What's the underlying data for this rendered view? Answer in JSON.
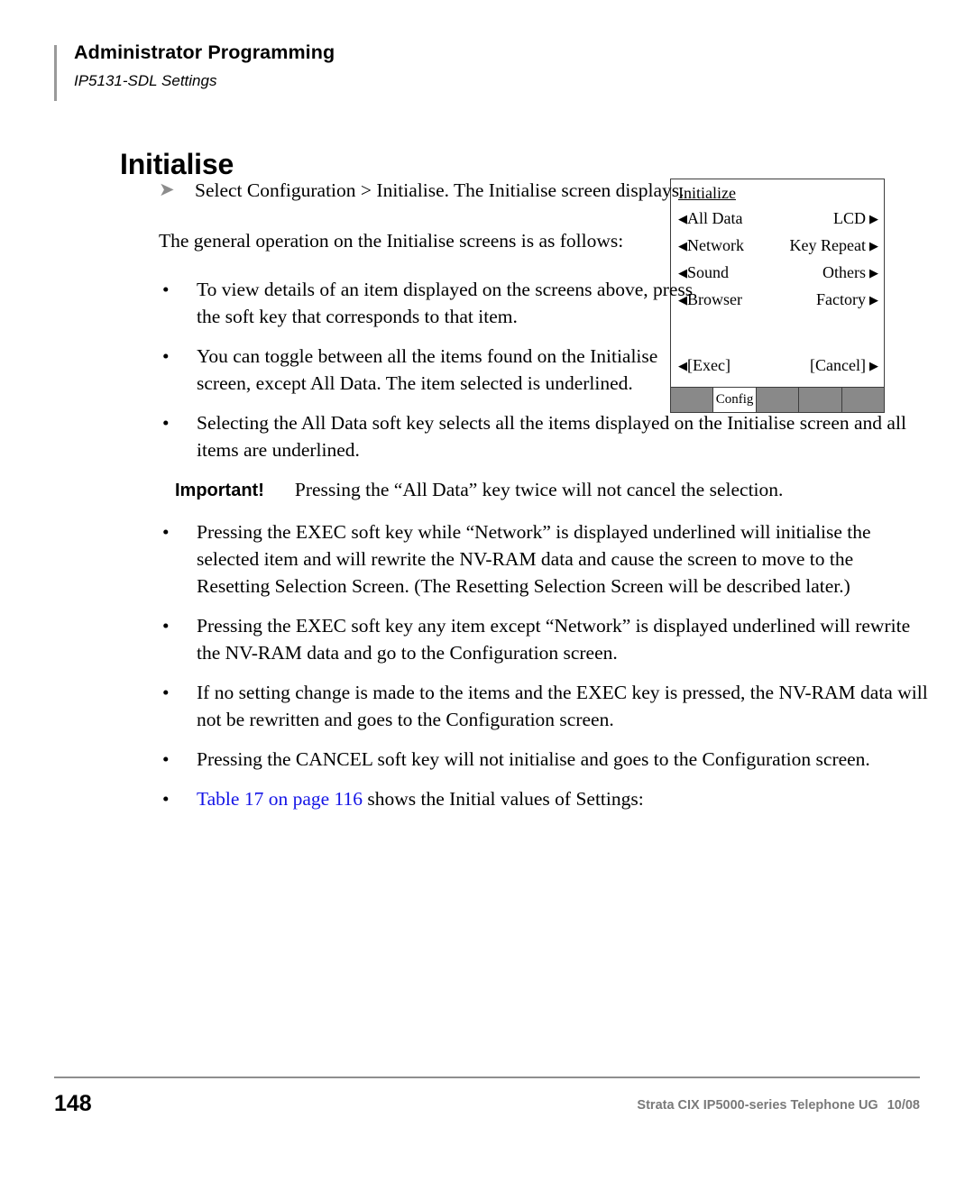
{
  "header": {
    "title": "Administrator Programming",
    "subtitle": "IP5131-SDL Settings"
  },
  "section": {
    "title": "Initialise"
  },
  "body": {
    "arrow_step": "Select Configuration > Initialise. The Initialise screen displays.",
    "intro": "The general operation on the Initialise screens is as follows:",
    "bullets": [
      "To view details of an item displayed on the screens above, press the soft key that corresponds to that item.",
      "You can toggle between all the items found on the Initialise screen, except All Data. The item selected is underlined.",
      "Selecting the All Data soft key selects all the items displayed on the Initialise screen and all items are underlined."
    ],
    "important": {
      "label": "Important!",
      "text": "Pressing the “All Data” key twice will not cancel the selection."
    },
    "bullets2": [
      "Pressing the EXEC soft key while “Network” is displayed underlined will initialise the selected item and will rewrite the NV-RAM data and cause the screen to move to the Resetting Selection Screen. (The Resetting Selection Screen will be described later.)",
      "Pressing the EXEC soft key any item except “Network” is displayed underlined will rewrite the NV-RAM data and go to the Configuration screen.",
      "If no setting change is made to the items and the EXEC key is pressed, the NV-RAM data will not be rewritten and goes to the Configuration screen.",
      "Pressing the CANCEL soft key will not initialise and goes to the Configuration screen."
    ],
    "table_ref": {
      "link": "Table 17 on page 116",
      "rest": " shows the Initial values of Settings:",
      "link_color": "#1414e6"
    }
  },
  "lcd": {
    "title": "Initialize",
    "rows": [
      {
        "left": "All Data",
        "right": "LCD"
      },
      {
        "left": "Network",
        "right": "Key Repeat"
      },
      {
        "left": "Sound",
        "right": "Others"
      },
      {
        "left": "Browser",
        "right": "Factory"
      }
    ],
    "exec_label": "[Exec]",
    "cancel_label": "[Cancel]",
    "left_arrow": "◀",
    "right_arrow": "▶",
    "tabs": [
      {
        "label": "",
        "active": false
      },
      {
        "label": "Config",
        "active": true
      },
      {
        "label": "",
        "active": false
      },
      {
        "label": "",
        "active": false
      },
      {
        "label": "",
        "active": false
      }
    ]
  },
  "footer": {
    "page_number": "148",
    "doc_title": "Strata CIX IP5000-series Telephone UG",
    "doc_date": "10/08"
  }
}
